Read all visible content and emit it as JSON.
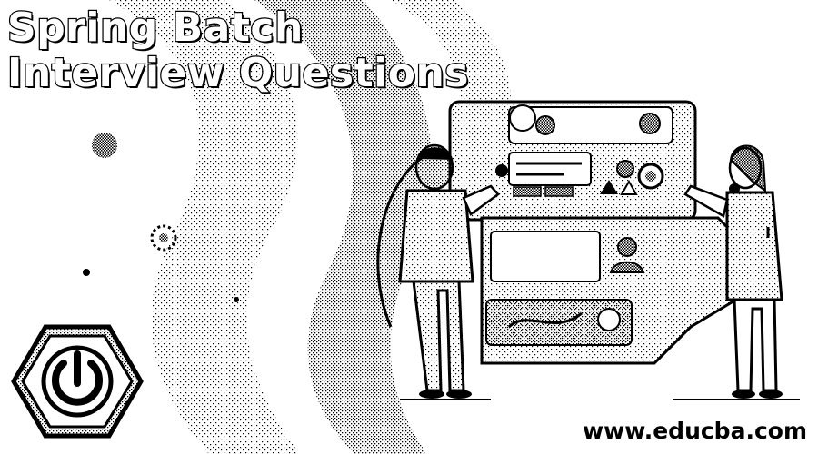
{
  "banner": {
    "title_line_1": "Spring Batch",
    "title_line_2": "Interview Questions",
    "site": "www.educba.com"
  },
  "illustration": {
    "badge_icon": "power-button-icon",
    "style": "black-and-white dithered",
    "colors": {
      "ink": "#000000",
      "paper": "#ffffff",
      "dither": "#8a8a8a"
    }
  }
}
